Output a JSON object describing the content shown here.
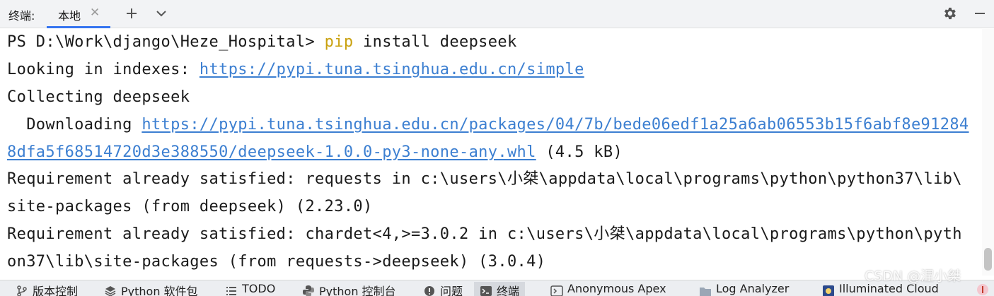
{
  "topbar": {
    "label": "终端:",
    "tab_label": "本地",
    "tab_close_icon": "close-icon",
    "add_icon": "plus-icon",
    "dropdown_icon": "chevron-down-icon",
    "settings_icon": "gear-icon",
    "minimize_icon": "minus-icon"
  },
  "terminal": {
    "prompt": "PS D:\\Work\\django\\Heze_Hospital> ",
    "command_keyword": "pip",
    "command_rest": " install deepseek",
    "indexes_prefix": "Looking in indexes: ",
    "indexes_url": "https://pypi.tuna.tsinghua.edu.cn/simple",
    "collecting": "Collecting deepseek",
    "downloading_prefix": "  Downloading ",
    "download_url_part1": "https://pypi.tuna.tsinghua.edu.cn/packages/04/7b/bede06edf1a25a6ab06553b15f6abf8e91284",
    "download_url_part2": "8dfa5f68514720d3e388550/deepseek-1.0.0-py3-none-any.whl",
    "download_size": " (4.5 kB)",
    "req1_line1": "Requirement already satisfied: requests in c:\\users\\小桀\\appdata\\local\\programs\\python\\python37\\lib\\",
    "req1_line2": "site-packages (from deepseek) (2.23.0)",
    "req2_line1": "Requirement already satisfied: chardet<4,>=3.0.2 in c:\\users\\小桀\\appdata\\local\\programs\\python\\pyth",
    "req2_line2": "on37\\lib\\site-packages (from requests->deepseek) (3.0.4)"
  },
  "bottombar": {
    "items": [
      {
        "label": "版本控制",
        "icon": "branch-icon"
      },
      {
        "label": "Python 软件包",
        "icon": "layers-icon"
      },
      {
        "label": "TODO",
        "icon": "list-icon"
      },
      {
        "label": "Python 控制台",
        "icon": "python-icon"
      },
      {
        "label": "问题",
        "icon": "warning-icon"
      },
      {
        "label": "终端",
        "icon": "terminal-icon"
      },
      {
        "label": "Anonymous Apex",
        "icon": "apex-icon"
      },
      {
        "label": "Log Analyzer",
        "icon": "folder-icon"
      },
      {
        "label": "Illuminated Cloud",
        "icon": "cloud-icon"
      }
    ]
  },
  "watermark": "CSDN @涅小桀",
  "colors": {
    "accent": "#3574f0",
    "link": "#3c7fd1",
    "keyword": "#c9a10f"
  }
}
